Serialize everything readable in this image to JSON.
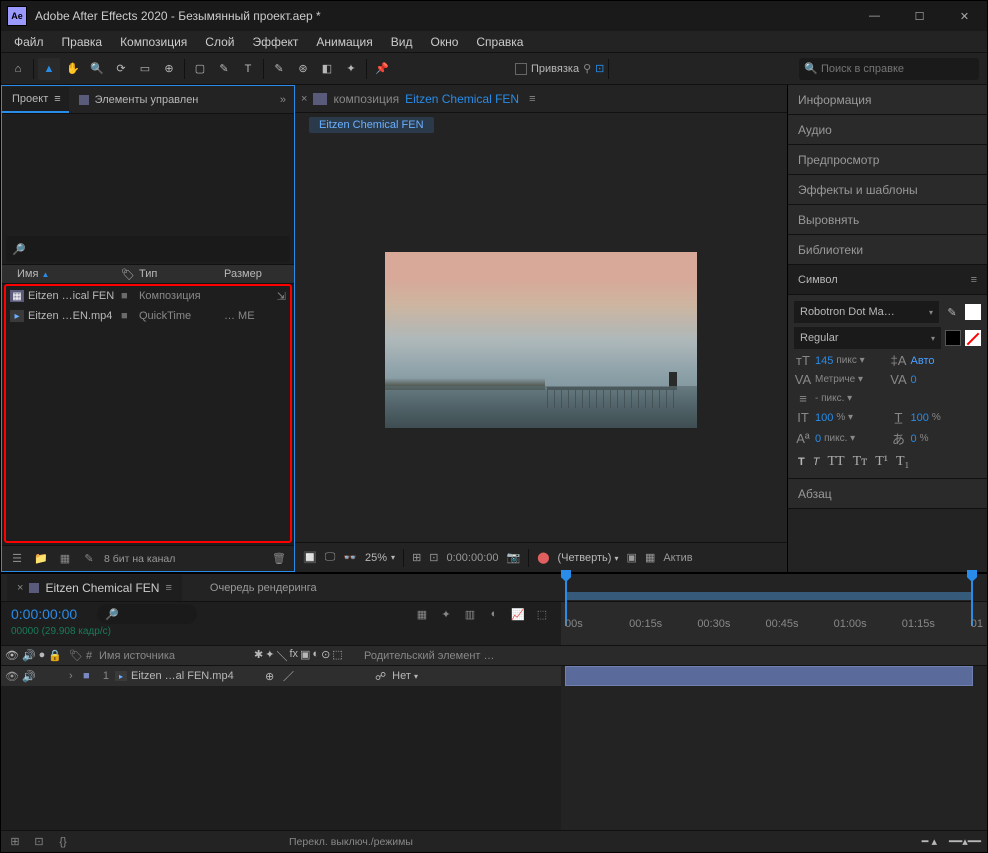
{
  "titlebar": {
    "app": "Adobe After Effects 2020 - Безымянный проект.aep *"
  },
  "menu": [
    "Файл",
    "Правка",
    "Композиция",
    "Слой",
    "Эффект",
    "Анимация",
    "Вид",
    "Окно",
    "Справка"
  ],
  "toolbar": {
    "snap_label": "Привязка",
    "search_placeholder": "Поиск в справке"
  },
  "project": {
    "tab_project": "Проект",
    "tab_controls": "Элементы управлен",
    "cols": {
      "name": "Имя",
      "type": "Тип",
      "size": "Размер"
    },
    "rows": [
      {
        "icon": "comp",
        "name": "Eitzen …ical FEN",
        "type": "Композиция",
        "size": ""
      },
      {
        "icon": "vid",
        "name": "Eitzen …EN.mp4",
        "type": "QuickTime",
        "size": "… ME"
      }
    ],
    "footer": {
      "bpc": "8 бит на канал"
    }
  },
  "viewer": {
    "label": "композиция",
    "name": "Eitzen Chemical FEN",
    "pill": "Eitzen Chemical FEN",
    "footer": {
      "zoom": "25%",
      "tc": "0:00:00:00",
      "res": "(Четверть)",
      "active": "Актив"
    }
  },
  "panels": {
    "info": "Информация",
    "audio": "Аудио",
    "preview": "Предпросмотр",
    "effects": "Эффекты и шаблоны",
    "align": "Выровнять",
    "libraries": "Библиотеки",
    "character": "Символ",
    "paragraph": "Абзац"
  },
  "character": {
    "font": "Robotron Dot Ma…",
    "style": "Regular",
    "size": "145",
    "size_unit": "пикс ▾",
    "leading": "Авто",
    "kerning": "Метриче ▾",
    "tracking": "0",
    "stroke": "- пикс. ▾",
    "vscale": "100",
    "vscale_u": "% ▾",
    "hscale": "100",
    "hscale_u": "%",
    "baseline": "0",
    "baseline_u": "пикс. ▾",
    "tsume": "0",
    "tsume_u": "%"
  },
  "timeline": {
    "tab": "Eitzen Chemical FEN",
    "queue": "Очередь рендеринга",
    "tc": "0:00:00:00",
    "fps": "00000 (29.908 кадр/с)",
    "col_source": "Имя источника",
    "col_parent": "Родительский элемент …",
    "ticks": [
      "00s",
      "00:15s",
      "00:30s",
      "00:45s",
      "01:00s",
      "01:15s",
      "01"
    ],
    "layer": {
      "num": "1",
      "name": "Eitzen …al FEN.mp4",
      "parent_none": "Нет"
    },
    "switches": "Перекл. выключ./режимы"
  }
}
